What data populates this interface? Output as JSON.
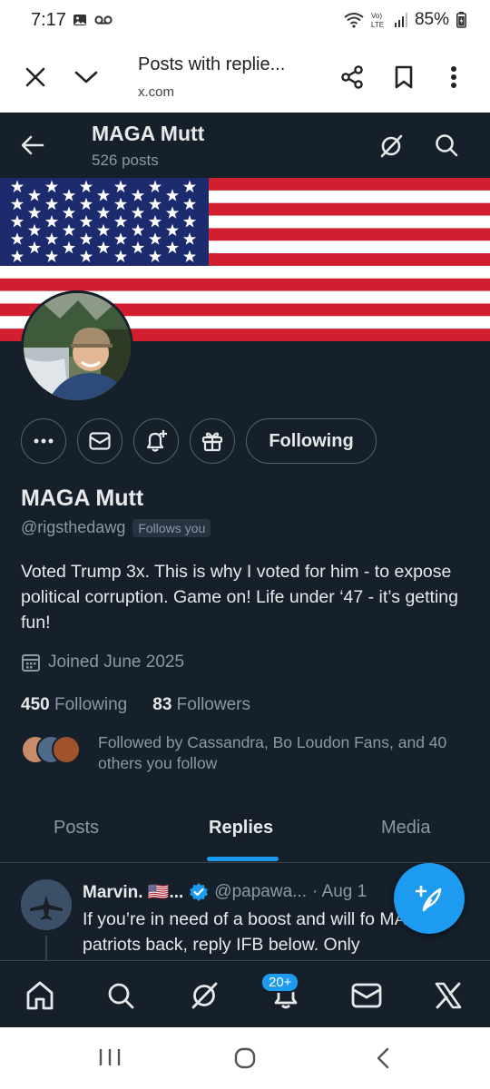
{
  "status_bar": {
    "time": "7:17",
    "battery": "85%"
  },
  "custom_tab": {
    "title": "Posts with replie...",
    "url": "x.com"
  },
  "profile_header": {
    "name": "MAGA Mutt",
    "post_count": "526 posts"
  },
  "profile": {
    "display_name": "MAGA Mutt",
    "handle": "@rigsthedawg",
    "follows_you": "Follows you",
    "bio": "Voted Trump 3x. This is why I voted for him - to expose political corruption.  Game on!  Life under ‘47 - it’s getting fun!",
    "joined": "Joined June 2025",
    "following_count": "450",
    "following_label": "Following",
    "followers_count": "83",
    "followers_label": "Followers",
    "followed_by": "Followed by Cassandra, Bo Loudon Fans, and 40 others you follow",
    "following_button": "Following"
  },
  "tabs": [
    {
      "label": "Posts",
      "active": false
    },
    {
      "label": "Replies",
      "active": true
    },
    {
      "label": "Media",
      "active": false
    }
  ],
  "post": {
    "author": "Marvin. 🇺🇸...",
    "handle": "@papawa...",
    "time": "· Aug 1",
    "text": "If you’re in need of a boost and will fo MAGA patriots back, reply IFB below. Only"
  },
  "bottom_nav": {
    "notification_badge": "20+"
  },
  "colors": {
    "background": "#15202b",
    "accent": "#1d9bf0",
    "text_primary": "#e7e9ea",
    "text_secondary": "#8b98a5"
  },
  "icons": [
    "close-icon",
    "chevron-down-icon",
    "share-icon",
    "bookmark-icon",
    "more-vert-icon",
    "back-arrow-icon",
    "grok-icon",
    "search-icon",
    "more-icon",
    "mail-icon",
    "notify-icon",
    "gift-icon",
    "calendar-icon",
    "verified-icon",
    "compose-icon",
    "home-icon",
    "x-logo-icon"
  ]
}
